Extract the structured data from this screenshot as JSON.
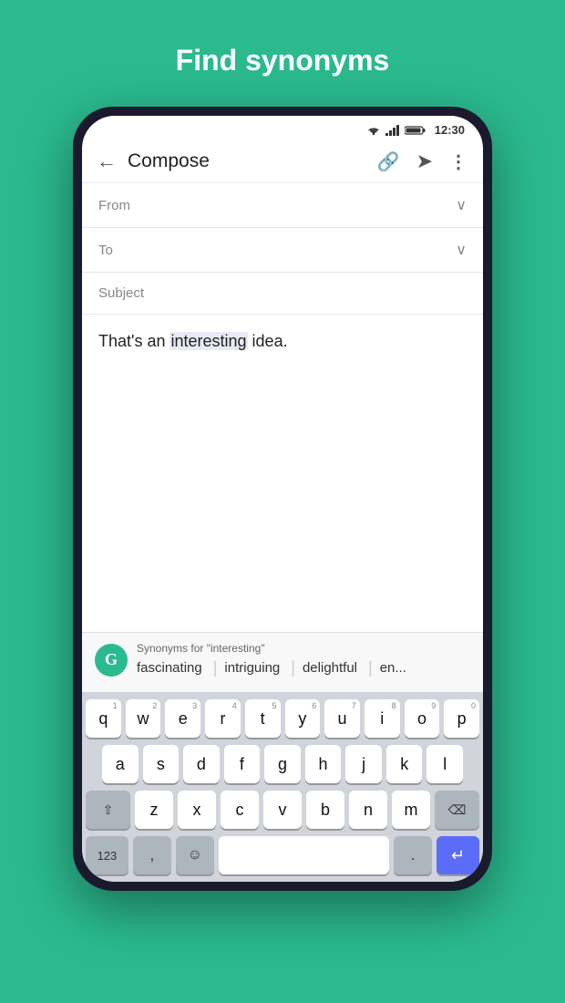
{
  "header": {
    "title": "Find synonyms"
  },
  "statusBar": {
    "time": "12:30"
  },
  "toolbar": {
    "title": "Compose"
  },
  "emailFields": {
    "fromLabel": "From",
    "toLabel": "To",
    "subjectLabel": "Subject"
  },
  "emailBody": {
    "text_before": "That's an ",
    "highlighted": "interesting",
    "text_after": " idea."
  },
  "synonymBar": {
    "header": "Synonyms for \"interesting\"",
    "words": [
      "fascinating",
      "intriguing",
      "delightful",
      "en..."
    ]
  },
  "keyboard": {
    "row1": [
      {
        "label": "q",
        "num": "1"
      },
      {
        "label": "w",
        "num": "2"
      },
      {
        "label": "e",
        "num": "3"
      },
      {
        "label": "r",
        "num": "4"
      },
      {
        "label": "t",
        "num": "5"
      },
      {
        "label": "y",
        "num": "6"
      },
      {
        "label": "u",
        "num": "7"
      },
      {
        "label": "i",
        "num": "8"
      },
      {
        "label": "o",
        "num": "9"
      },
      {
        "label": "p",
        "num": "0"
      }
    ],
    "row2": [
      {
        "label": "a"
      },
      {
        "label": "s"
      },
      {
        "label": "d"
      },
      {
        "label": "f"
      },
      {
        "label": "g"
      },
      {
        "label": "h"
      },
      {
        "label": "j"
      },
      {
        "label": "k"
      },
      {
        "label": "l"
      }
    ],
    "row3_special_left": "⇧",
    "row3": [
      {
        "label": "z"
      },
      {
        "label": "x"
      },
      {
        "label": "c"
      },
      {
        "label": "v"
      },
      {
        "label": "b"
      },
      {
        "label": "n"
      },
      {
        "label": "m"
      }
    ],
    "row3_backspace": "⌫",
    "row4_123": "123",
    "row4_comma": ",",
    "row4_emoji": "☺",
    "row4_space": "",
    "row4_dot": ".",
    "row4_enter": "↵"
  }
}
